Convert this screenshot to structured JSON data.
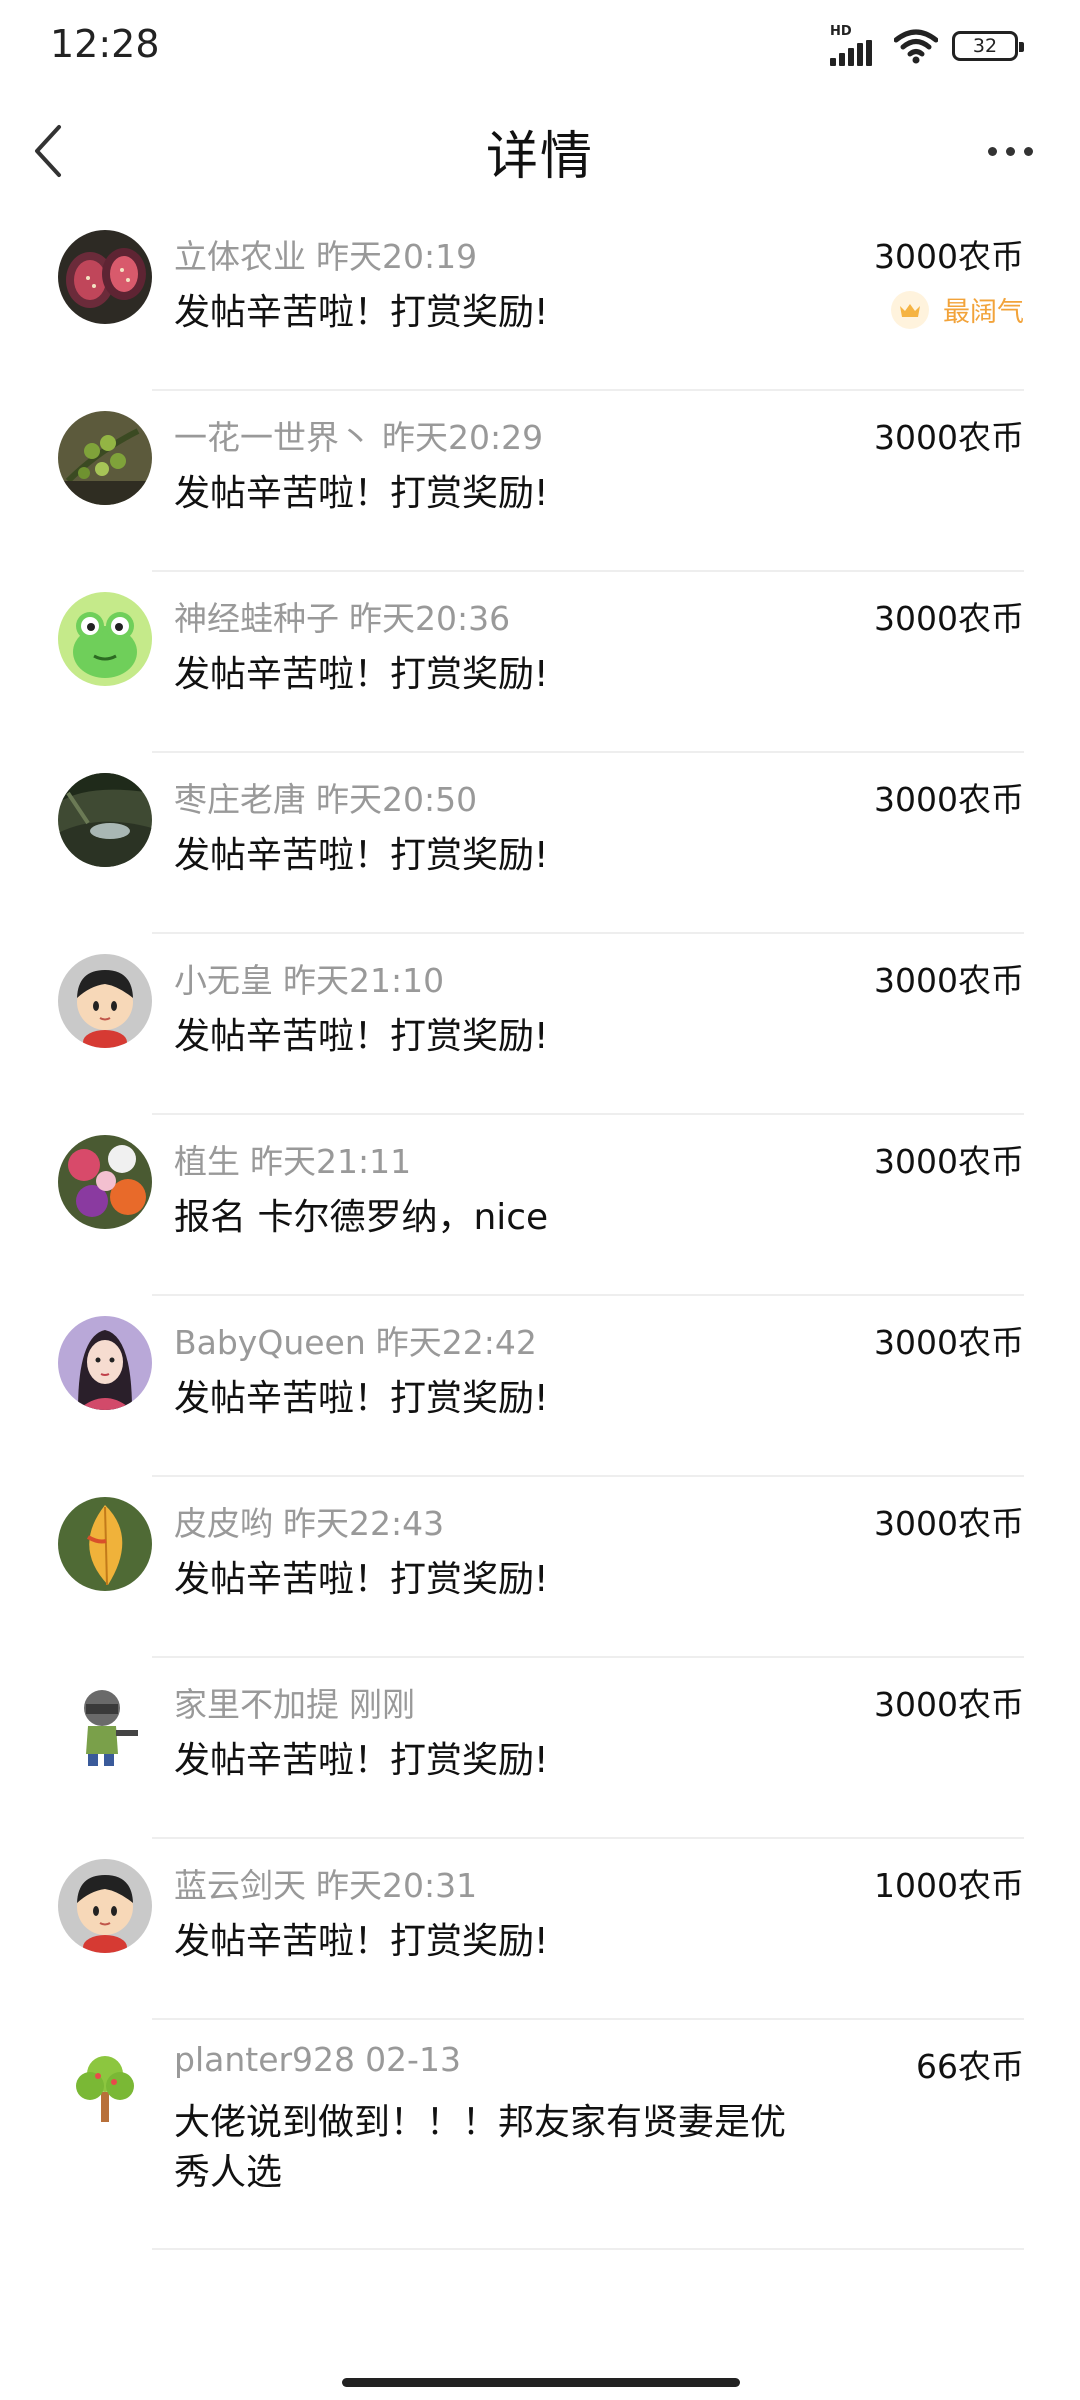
{
  "status_bar": {
    "time": "12:28",
    "hd_label": "HD",
    "battery": "32"
  },
  "header": {
    "title": "详情",
    "back_icon": "chevron-left-icon",
    "more_icon": "more-horizontal-icon"
  },
  "rewards": [
    {
      "user": "立体农业",
      "time": "昨天20:19",
      "message": "发帖辛苦啦！打赏奖励!",
      "amount": "3000农币",
      "badge": "最阔气",
      "avatar": "fig-fruit-avatar"
    },
    {
      "user": "一花一世界丶",
      "time": "昨天20:29",
      "message": "发帖辛苦啦！打赏奖励!",
      "amount": "3000农币",
      "avatar": "green-berries-avatar"
    },
    {
      "user": "神经蛙种子",
      "time": "昨天20:36",
      "message": "发帖辛苦啦！打赏奖励!",
      "amount": "3000农币",
      "avatar": "cartoon-frog-avatar"
    },
    {
      "user": "枣庄老唐",
      "time": "昨天20:50",
      "message": "发帖辛苦啦！打赏奖励!",
      "amount": "3000农币",
      "avatar": "landscape-avatar"
    },
    {
      "user": "小无皇",
      "time": "昨天21:10",
      "message": "发帖辛苦啦！打赏奖励!",
      "amount": "3000农币",
      "avatar": "cartoon-boy-avatar"
    },
    {
      "user": "植生",
      "time": "昨天21:11",
      "message": "报名 卡尔德罗纳，nice",
      "amount": "3000农币",
      "avatar": "flowers-avatar"
    },
    {
      "user": "BabyQueen",
      "time": "昨天22:42",
      "message": "发帖辛苦啦！打赏奖励!",
      "amount": "3000农币",
      "avatar": "woman-portrait-avatar"
    },
    {
      "user": "皮皮哟",
      "time": "昨天22:43",
      "message": "发帖辛苦啦！打赏奖励!",
      "amount": "3000农币",
      "avatar": "autumn-leaf-avatar"
    },
    {
      "user": "家里不加提",
      "time": "刚刚",
      "message": "发帖辛苦啦！打赏奖励!",
      "amount": "3000农币",
      "avatar": "cartoon-soldier-avatar"
    },
    {
      "user": "蓝云剑天",
      "time": "昨天20:31",
      "message": "发帖辛苦啦！打赏奖励!",
      "amount": "1000农币",
      "avatar": "cartoon-boy-avatar"
    },
    {
      "user": "planter928",
      "time": "02-13",
      "message": "大佬说到做到！！！邦友家有贤妻是优秀人选",
      "amount": "66农币",
      "avatar": "tree-avatar"
    }
  ],
  "colors": {
    "meta_text": "#999999",
    "badge": "#f2a33a",
    "divider": "#eeeeee"
  }
}
